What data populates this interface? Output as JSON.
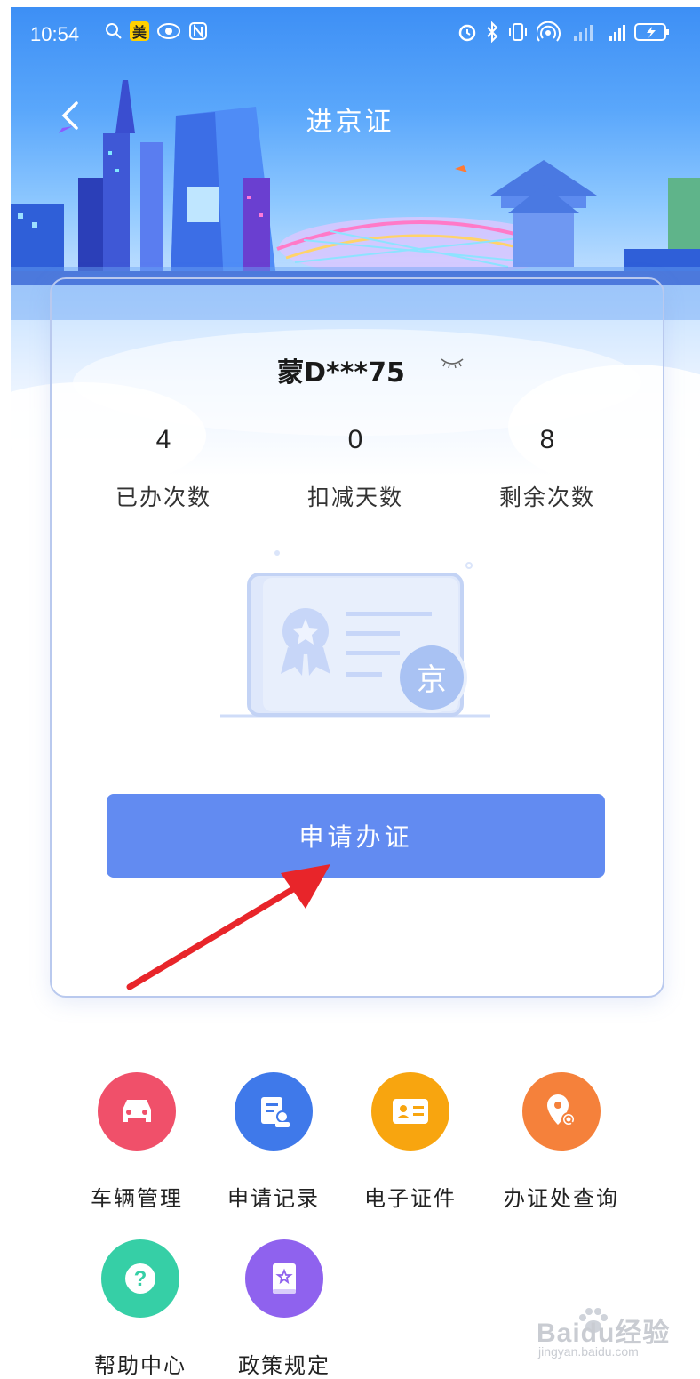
{
  "status_bar": {
    "time": "10:54",
    "meituan_badge": "美"
  },
  "header": {
    "title": "进京证"
  },
  "permit": {
    "plate": "蒙D***75",
    "stats": [
      {
        "value": "4",
        "label": "已办次数"
      },
      {
        "value": "0",
        "label": "扣减天数"
      },
      {
        "value": "8",
        "label": "剩余次数"
      }
    ],
    "illustration_badge": "京",
    "apply_button": "申请办证"
  },
  "menu": [
    {
      "label": "车辆管理",
      "icon": "car-icon",
      "color": "#f0506a"
    },
    {
      "label": "申请记录",
      "icon": "record-icon",
      "color": "#3f79ea"
    },
    {
      "label": "电子证件",
      "icon": "id-card-icon",
      "color": "#f8a50f"
    },
    {
      "label": "办证处查询",
      "icon": "location-search-icon",
      "color": "#f5813b"
    },
    {
      "label": "帮助中心",
      "icon": "help-icon",
      "color": "#36cfa6"
    },
    {
      "label": "政策规定",
      "icon": "policy-book-icon",
      "color": "#8f62ee"
    }
  ],
  "watermark": {
    "brand": "Baidu经验",
    "url": "jingyan.baidu.com"
  }
}
